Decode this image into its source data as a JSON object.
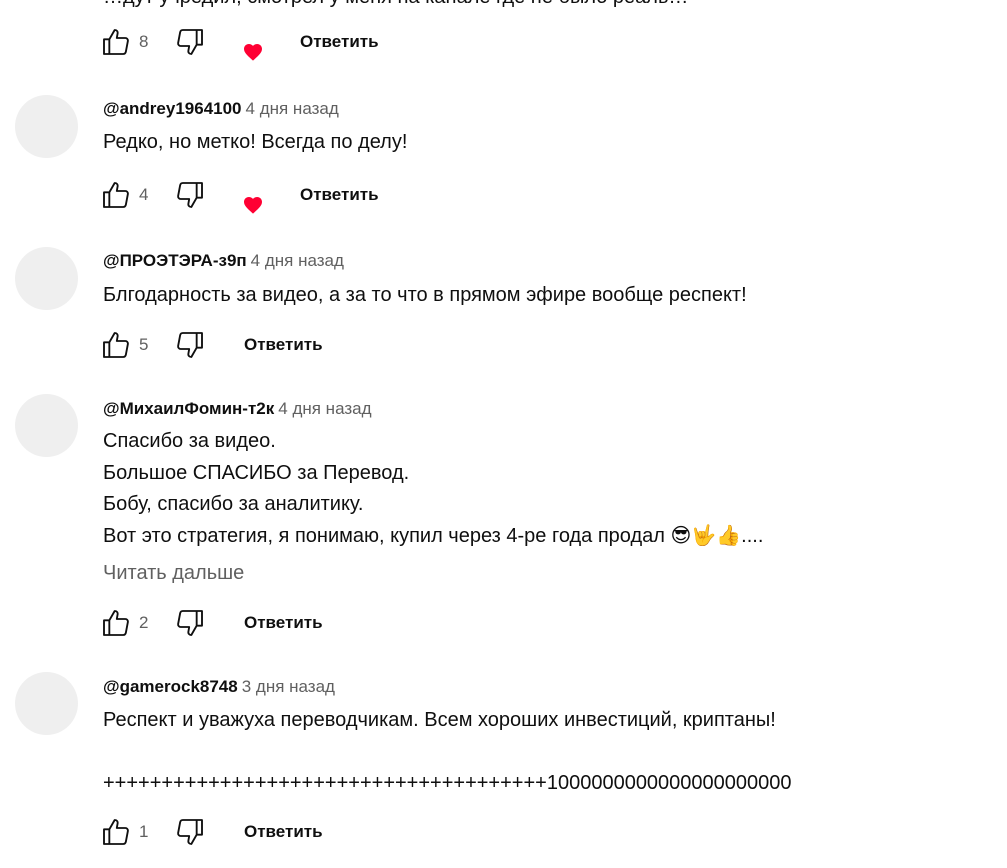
{
  "partial_top_text": "…дут учредил, смотрел у меня на канале где не было реаль…",
  "reply_label": "Ответить",
  "read_more_label": "Читать дальше",
  "top_actions": {
    "likes": "8"
  },
  "comments": [
    {
      "author": "@andrey1964100",
      "time": "4 дня назад",
      "lines": [
        "Редко, но метко! Всегда по делу!"
      ],
      "likes": "4",
      "hearted": true
    },
    {
      "author": "@ПРОЭТЭРА-з9п",
      "time": "4 дня назад",
      "lines": [
        "Блгодарность за видео, а за то что в прямом эфире вообще респект!"
      ],
      "likes": "5",
      "hearted": false
    },
    {
      "author": "@МихаилФомин-т2к",
      "time": "4 дня назад",
      "lines": [
        "Спасибо за видео.",
        "Большое СПАСИБО за Перевод.",
        "Бобу, спасибо за аналитику.",
        "Вот это стратегия, я понимаю, купил через 4-ре года продал 😎🤟👍...."
      ],
      "likes": "2",
      "hearted": false,
      "read_more": true
    },
    {
      "author": "@gamerock8748",
      "time": "3 дня назад",
      "lines": [
        "Респект и уважуха переводчикам. Всем хороших инвестиций, криптаны!",
        "",
        "++++++++++++++++++++++++++++++++++++++1000000000000000000000"
      ],
      "likes": "1",
      "hearted": false
    }
  ],
  "colors": {
    "heart": "#ff0033",
    "secondary_text": "#606060",
    "avatar": "#efefef"
  }
}
